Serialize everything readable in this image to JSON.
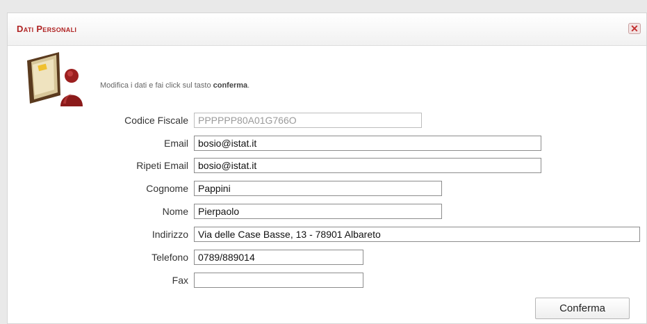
{
  "dialog": {
    "title": "Dati Personali",
    "close_icon": "close-icon"
  },
  "intro": {
    "text": "Modifica i dati e fai click sul tasto ",
    "bold": "conferma",
    "tail": "."
  },
  "fields": {
    "codice_fiscale": {
      "label": "Codice Fiscale",
      "value": "PPPPPP80A01G766O"
    },
    "email": {
      "label": "Email",
      "value": "bosio@istat.it"
    },
    "ripeti_email": {
      "label": "Ripeti Email",
      "value": "bosio@istat.it"
    },
    "cognome": {
      "label": "Cognome",
      "value": "Pappini"
    },
    "nome": {
      "label": "Nome",
      "value": "Pierpaolo"
    },
    "indirizzo": {
      "label": "Indirizzo",
      "value": "Via delle Case Basse, 13 - 78901 Albareto"
    },
    "telefono": {
      "label": "Telefono",
      "value": "0789/889014"
    },
    "fax": {
      "label": "Fax",
      "value": ""
    }
  },
  "buttons": {
    "confirm": "Conferma"
  },
  "colors": {
    "title": "#b02424",
    "accent_red": "#c23030"
  }
}
